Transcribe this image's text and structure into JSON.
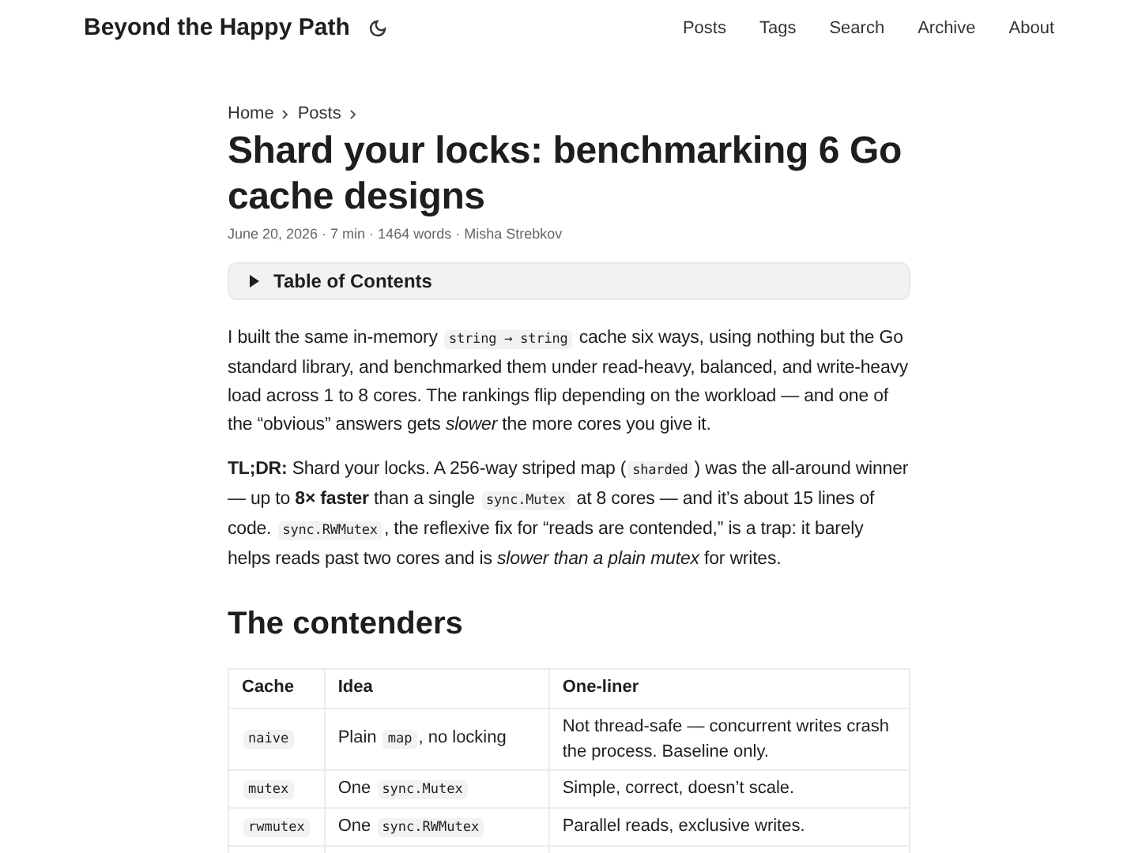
{
  "site": {
    "title": "Beyond the Happy Path",
    "nav": [
      {
        "label": "Posts"
      },
      {
        "label": "Tags"
      },
      {
        "label": "Search"
      },
      {
        "label": "Archive"
      },
      {
        "label": "About"
      }
    ]
  },
  "breadcrumbs": [
    {
      "label": "Home"
    },
    {
      "label": "Posts"
    }
  ],
  "post": {
    "title": "Shard your locks: benchmarking 6 Go cache designs",
    "meta": "June 20, 2026 · 7 min · 1464 words · Misha Strebkov",
    "toc": {
      "label": "Table of Contents",
      "expanded": false
    },
    "paragraphs": [
      [
        {
          "kind": "text",
          "text": "I built the same in-memory "
        },
        {
          "kind": "code",
          "text": "string → string"
        },
        {
          "kind": "text",
          "text": " cache six ways, using nothing but the Go standard library, and benchmarked them under read-heavy, balanced, and write-heavy load across 1 to 8 cores. The rankings flip depending on the workload — and one of the “obvious” answers gets *slower* the more cores you give it."
        }
      ],
      [
        {
          "kind": "text",
          "text": "**TL;DR:** Shard your locks. A 256-way striped map ("
        },
        {
          "kind": "code",
          "text": "sharded"
        },
        {
          "kind": "text",
          "text": ") was the all-around winner — up to **8× faster** than a single "
        },
        {
          "kind": "code",
          "text": "sync.Mutex"
        },
        {
          "kind": "text",
          "text": " at 8 cores — and it’s about 15 lines of code. "
        },
        {
          "kind": "code",
          "text": "sync.RWMutex"
        },
        {
          "kind": "text",
          "text": ", the reflexive fix for “reads are contended,” is a trap: it barely helps reads past two cores and is *slower than a plain mutex* for writes."
        }
      ]
    ],
    "section_heading": "The contenders",
    "table": {
      "columns": [
        "Cache",
        "Idea",
        "One-liner"
      ],
      "rows": [
        [
          [
            {
              "kind": "code",
              "text": "naive"
            }
          ],
          [
            {
              "kind": "text",
              "text": "Plain "
            },
            {
              "kind": "code",
              "text": "map"
            },
            {
              "kind": "text",
              "text": ", no locking"
            }
          ],
          [
            {
              "kind": "text",
              "text": "Not thread-safe — concurrent writes crash the process. Baseline only."
            }
          ]
        ],
        [
          [
            {
              "kind": "code",
              "text": "mutex"
            }
          ],
          [
            {
              "kind": "text",
              "text": "One "
            },
            {
              "kind": "code",
              "text": "sync.Mutex"
            }
          ],
          [
            {
              "kind": "text",
              "text": "Simple, correct, doesn’t scale."
            }
          ]
        ],
        [
          [
            {
              "kind": "code",
              "text": "rwmutex"
            }
          ],
          [
            {
              "kind": "text",
              "text": "One "
            },
            {
              "kind": "code",
              "text": "sync.RWMutex"
            }
          ],
          [
            {
              "kind": "text",
              "text": "Parallel reads, exclusive writes."
            }
          ]
        ]
      ]
    }
  }
}
